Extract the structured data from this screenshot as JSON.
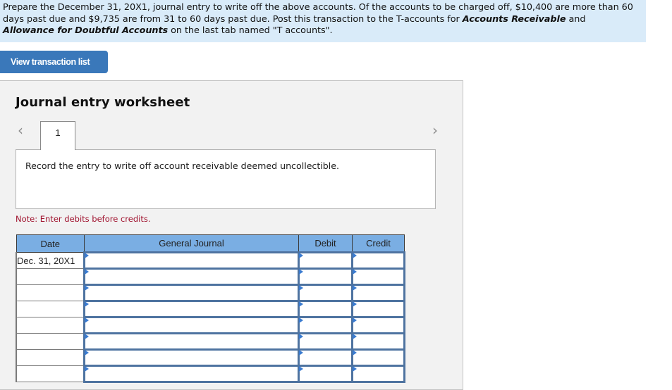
{
  "instructions": {
    "text_1": "Prepare the December 31, 20X1, journal entry to write off the above accounts. Of the accounts to be charged off, $10,400 are more than 60 days past due and $9,735 are from 31 to 60 days past due. Post this transaction to the T-accounts for ",
    "bold_1": "Accounts Receivable",
    "text_2": " and ",
    "bold_2": "Allowance for Doubtful Accounts",
    "text_3": " on the last tab named \"T accounts\"."
  },
  "buttons": {
    "view_transaction_list": "View transaction list"
  },
  "worksheet": {
    "title": "Journal entry worksheet",
    "prev_icon": "chevron-left-icon",
    "next_icon": "chevron-right-icon",
    "prev_glyph": "‹",
    "next_glyph": "›",
    "tabs": [
      {
        "label": "1",
        "active": true
      }
    ],
    "prompt": "Record the entry to write off account receivable deemed uncollectible.",
    "note": "Note: Enter debits before credits."
  },
  "journal": {
    "columns": [
      "Date",
      "General Journal",
      "Debit",
      "Credit"
    ],
    "rows": [
      {
        "date": "Dec. 31, 20X1",
        "account": "",
        "debit": "",
        "credit": ""
      },
      {
        "date": "",
        "account": "",
        "debit": "",
        "credit": ""
      },
      {
        "date": "",
        "account": "",
        "debit": "",
        "credit": ""
      },
      {
        "date": "",
        "account": "",
        "debit": "",
        "credit": ""
      },
      {
        "date": "",
        "account": "",
        "debit": "",
        "credit": ""
      },
      {
        "date": "",
        "account": "",
        "debit": "",
        "credit": ""
      },
      {
        "date": "",
        "account": "",
        "debit": "",
        "credit": ""
      },
      {
        "date": "",
        "account": "",
        "debit": "",
        "credit": ""
      }
    ]
  },
  "colors": {
    "instructions_bg": "#d9ebf9",
    "button_bg": "#3a78ba",
    "header_bg": "#7aaee3",
    "input_border": "#4e73a0",
    "note_text": "#a0122e"
  }
}
